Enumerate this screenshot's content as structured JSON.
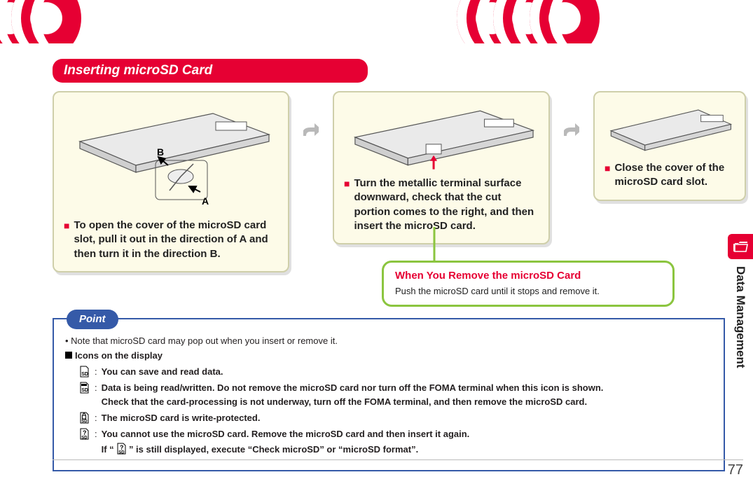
{
  "heading": "Inserting microSD Card",
  "steps": {
    "s1": "To open the cover of the microSD card slot, pull it out in the direction of A and then turn it in the direction B.",
    "s2": "Turn the metallic terminal surface downward, check that the cut portion comes to the right, and then insert the microSD card.",
    "s3": "Close the cover of the microSD card slot."
  },
  "diagram_labels": {
    "a": "A",
    "b": "B"
  },
  "callout": {
    "title": "When You Remove the microSD Card",
    "body": "Push the microSD card until it stops and remove it."
  },
  "point": {
    "tab": "Point",
    "bullet1": "Note that microSD card may pop out when you insert or remove it.",
    "icons_heading": "Icons on the display",
    "row1": "You can save and read data.",
    "row2a": "Data is being read/written. Do not remove the microSD card nor turn off the FOMA terminal when this icon is shown.",
    "row2b": "Check that the card-processing is not underway, turn off the FOMA terminal, and then remove the microSD card.",
    "row3": "The microSD card is write-protected.",
    "row4a": "You cannot use the microSD card. Remove the microSD card and then insert it again.",
    "row4b_pre": "If “",
    "row4b_post": "” is still displayed, execute “Check microSD” or “microSD format”."
  },
  "side_tab": "Data Management",
  "page_number": "77"
}
